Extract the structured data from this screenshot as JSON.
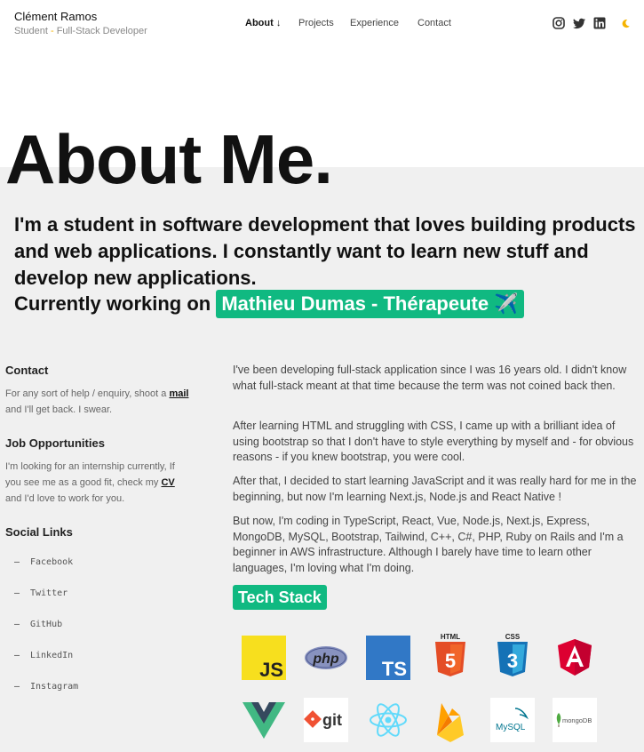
{
  "header": {
    "name": "Clément Ramos",
    "subtitle_pre": "Student ",
    "subtitle_dash": "-",
    "subtitle_post": " Full-Stack Developer",
    "nav": [
      "About ↓",
      "Projects",
      "Experience",
      "Contact"
    ],
    "social_icons": [
      "instagram-icon",
      "twitter-icon",
      "linkedin-icon",
      "moon-icon"
    ]
  },
  "hero": {
    "title": "About Me.",
    "intro": "I'm a student in software development that loves building products and web applications. I constantly want to learn new stuff and develop new applications.",
    "working_prefix": "Currently working on ",
    "working_project": "Mathieu Dumas - Thérapeute ✈️"
  },
  "sidebar": {
    "contact_title": "Contact",
    "contact_pre": "For any sort of help / enquiry, shoot a ",
    "contact_link": "mail",
    "contact_post": " and I'll get back. I swear.",
    "jobs_title": "Job Opportunities",
    "jobs_pre": "I'm looking for an internship currently, If you see me as a good fit, check my ",
    "jobs_link": "CV",
    "jobs_post": " and I'd love to work for you.",
    "social_title": "Social Links",
    "social_links": [
      "Facebook",
      "Twitter",
      "GitHub",
      "LinkedIn",
      "Instagram"
    ]
  },
  "main": {
    "paragraphs": [
      "I've been developing full-stack application since I was 16 years old. I didn't know what full-stack meant at that time because the term was not coined back then.",
      "After learning HTML and struggling with CSS, I came up with a brilliant idea of using bootstrap so that I don't have to style everything by myself and - for obvious reasons - if you knew bootstrap, you were cool.",
      "After that, I decided to start learning JavaScript and it was really hard for me in the beginning, but now I'm learning Next.js, Node.js and React Native !",
      "But now, I'm coding in TypeScript, React, Vue, Node.js, Next.js, Express, MongoDB, MySQL, Bootstrap, Tailwind, C++, C#, PHP, Ruby on Rails and I'm a beginner in AWS infrastructure. Although I barely have time to learn other languages, I'm loving what I'm doing."
    ],
    "tech_title": "Tech Stack",
    "logo_texts": {
      "js": "JS",
      "php": "php",
      "ts": "TS",
      "html": "HTML",
      "css": "CSS",
      "git": "git",
      "mysql": "MySQL",
      "mongo": "mongoDB"
    }
  },
  "colors": {
    "accent": "#10b981",
    "moon": "#f5b301"
  }
}
